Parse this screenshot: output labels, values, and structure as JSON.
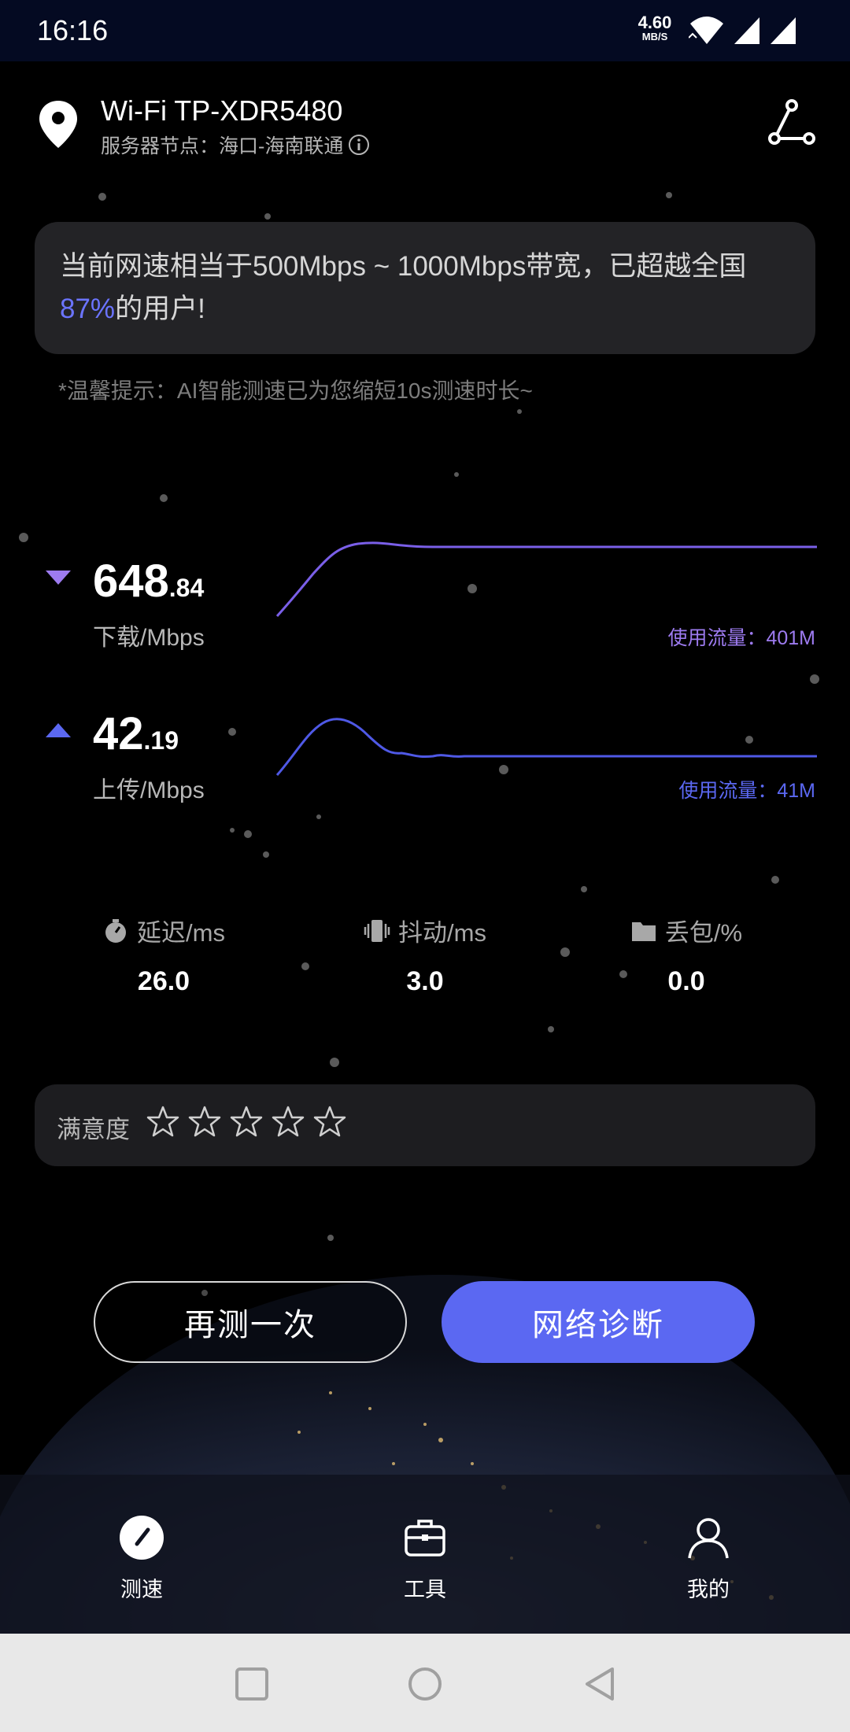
{
  "status_bar": {
    "time": "16:16",
    "net_speed": "4.60",
    "net_speed_unit": "MB/S"
  },
  "header": {
    "wifi_name": "Wi-Fi TP-XDR5480",
    "server_label": "服务器节点：",
    "server_name": "海口-海南联通"
  },
  "result": {
    "text_before": "当前网速相当于500Mbps ~ 1000Mbps带宽，已超越全国",
    "percent": "87%",
    "text_after": "的用户!"
  },
  "tip": "*温馨提示：AI智能测速已为您缩短10s测速时长~",
  "download": {
    "int": "648",
    "dec": ".84",
    "unit": "下载/Mbps",
    "traffic": "使用流量：401M",
    "color": "#9d7bf0"
  },
  "upload": {
    "int": "42",
    "dec": ".19",
    "unit": "上传/Mbps",
    "traffic": "使用流量：41M",
    "color": "#5b68f2"
  },
  "stats": {
    "latency": {
      "label": "延迟/ms",
      "value": "26.0",
      "icon": "stopwatch-icon"
    },
    "jitter": {
      "label": "抖动/ms",
      "value": "3.0",
      "icon": "vibration-icon"
    },
    "loss": {
      "label": "丢包/%",
      "value": "0.0",
      "icon": "folder-icon"
    }
  },
  "rating": {
    "label": "满意度",
    "stars": 0,
    "max": 5
  },
  "buttons": {
    "retest": "再测一次",
    "diagnose": "网络诊断"
  },
  "nav": [
    {
      "label": "测速",
      "icon": "speedometer-icon",
      "active": true
    },
    {
      "label": "工具",
      "icon": "toolbox-icon",
      "active": false
    },
    {
      "label": "我的",
      "icon": "person-icon",
      "active": false
    }
  ],
  "colors": {
    "accent": "#5b68f2",
    "download": "#9d7bf0",
    "card": "#232326",
    "background": "#000000"
  }
}
